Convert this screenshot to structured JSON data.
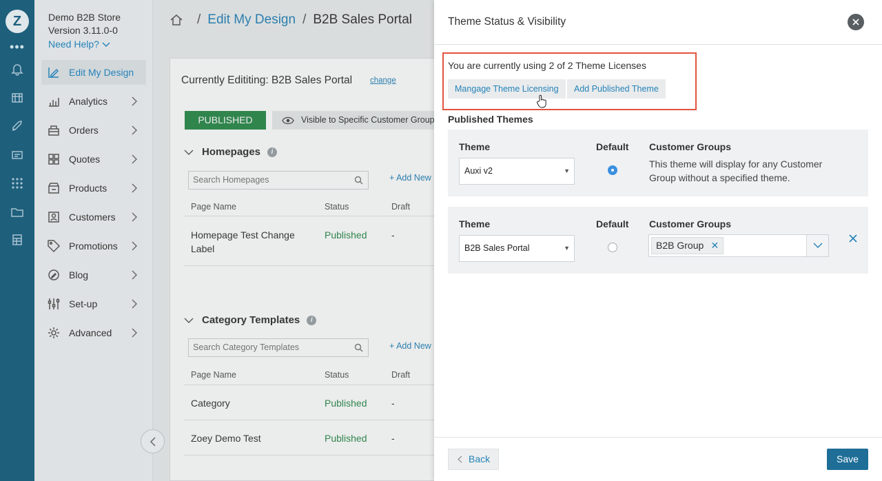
{
  "store": {
    "name": "Demo B2B Store",
    "version": "Version 3.11.0-0",
    "help": "Need Help?"
  },
  "rail": {
    "more": "•••"
  },
  "nav": {
    "items": [
      {
        "label": "Edit My Design",
        "icon": "edit-design-icon"
      },
      {
        "label": "Analytics",
        "icon": "analytics-icon"
      },
      {
        "label": "Orders",
        "icon": "orders-icon"
      },
      {
        "label": "Quotes",
        "icon": "quotes-icon"
      },
      {
        "label": "Products",
        "icon": "products-icon"
      },
      {
        "label": "Customers",
        "icon": "customers-icon"
      },
      {
        "label": "Promotions",
        "icon": "promotions-icon"
      },
      {
        "label": "Blog",
        "icon": "blog-icon"
      },
      {
        "label": "Set-up",
        "icon": "setup-icon"
      },
      {
        "label": "Advanced",
        "icon": "gear-icon"
      }
    ]
  },
  "breadcrumb": {
    "sep1": "/",
    "link": "Edit My Design",
    "sep2": "/",
    "current": "B2B Sales Portal"
  },
  "main": {
    "currently": "Currently Edititing: B2B Sales Portal",
    "change": "change",
    "status": "PUBLISHED",
    "visibility": "Visible to Specific Customer Groups",
    "homepages": {
      "title": "Homepages",
      "search_placeholder": "Search Homepages",
      "add": "+ Add New",
      "cols": [
        "Page Name",
        "Status",
        "Draft"
      ],
      "rows": [
        {
          "name": "Homepage Test Change Label",
          "status": "Published",
          "draft": "-"
        }
      ]
    },
    "category": {
      "title": "Category Templates",
      "search_placeholder": "Search Category Templates",
      "add": "+ Add New",
      "cols": [
        "Page Name",
        "Status",
        "Draft"
      ],
      "rows": [
        {
          "name": "Category",
          "status": "Published",
          "draft": "-"
        },
        {
          "name": "Zoey Demo Test",
          "status": "Published",
          "draft": "-"
        }
      ]
    }
  },
  "panel": {
    "title": "Theme Status & Visibility",
    "license_text": "You are currently using 2 of 2 Theme Licenses",
    "manage_btn": "Mangage Theme Licensing",
    "add_btn": "Add Published Theme",
    "published_heading": "Published Themes",
    "themes": [
      {
        "theme_label": "Theme",
        "default_label": "Default",
        "groups_label": "Customer Groups",
        "theme": "Auxi v2",
        "default": true,
        "groups_text": "This theme will display for any Customer Group without a specified theme."
      },
      {
        "theme_label": "Theme",
        "default_label": "Default",
        "groups_label": "Customer Groups",
        "theme": "B2B Sales Portal",
        "default": false,
        "chip": "B2B Group",
        "chip_remove": "✕"
      }
    ],
    "back": "Back",
    "save": "Save"
  },
  "colors": {
    "rail": "#1e5f7c",
    "accent": "#2583b9",
    "published": "#2b8a4a",
    "save": "#1e6e97",
    "highlight": "#e2533e"
  }
}
